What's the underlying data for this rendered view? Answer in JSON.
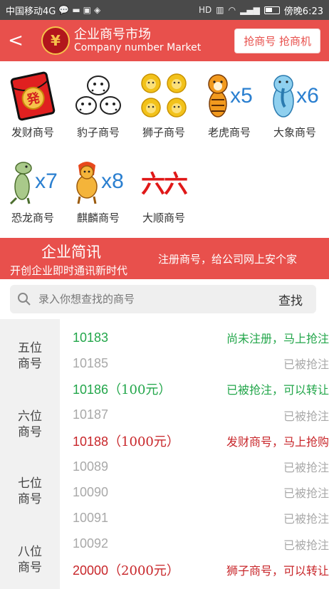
{
  "status_bar": {
    "carrier": "中国移动4G",
    "time": "傍晚6:23"
  },
  "header": {
    "back": "<",
    "logo": "¥",
    "title_cn": "企业商号市场",
    "title_en": "Company number Market",
    "grab_button": "抢商号 抢商机"
  },
  "categories": [
    {
      "label": "发财商号",
      "icon": "red-envelope-fa"
    },
    {
      "label": "豹子商号",
      "icon": "three-leopards"
    },
    {
      "label": "狮子商号",
      "icon": "four-lions"
    },
    {
      "label": "老虎商号",
      "icon": "tiger",
      "multiplier": "x5"
    },
    {
      "label": "大象商号",
      "icon": "elephant",
      "multiplier": "x6"
    },
    {
      "label": "恐龙商号",
      "icon": "dinosaur",
      "multiplier": "x7"
    },
    {
      "label": "麒麟商号",
      "icon": "qilin",
      "multiplier": "x8"
    },
    {
      "label": "大顺商号",
      "icon": "liu-liu-characters",
      "glyphs": "六六"
    }
  ],
  "banner": {
    "title": "企业简讯",
    "subtitle": "开创企业即时通讯新时代",
    "slogan": "注册商号，给公司网上安个家"
  },
  "search": {
    "placeholder": "录入你想查找的商号",
    "button": "查找"
  },
  "groups": [
    {
      "line1": "五位",
      "line2": "商号"
    },
    {
      "line1": "六位",
      "line2": "商号"
    },
    {
      "line1": "七位",
      "line2": "商号"
    },
    {
      "line1": "八位",
      "line2": "商号"
    }
  ],
  "numbers": [
    {
      "number": "10183",
      "price": "",
      "status": "尚未注册，马上抢注",
      "color": "#22a64a"
    },
    {
      "number": "10185",
      "price": "",
      "status": "已被抢注",
      "color": "#a9a9a9"
    },
    {
      "number": "10186",
      "price": "（100元）",
      "status": "已被抢注，可以转让",
      "color": "#22a64a"
    },
    {
      "number": "10187",
      "price": "",
      "status": "已被抢注",
      "color": "#a9a9a9"
    },
    {
      "number": "10188",
      "price": "（1000元）",
      "status": "发财商号，马上抢购",
      "color": "#c8262a"
    },
    {
      "number": "10089",
      "price": "",
      "status": "已被抢注",
      "color": "#a9a9a9"
    },
    {
      "number": "10090",
      "price": "",
      "status": "已被抢注",
      "color": "#a9a9a9"
    },
    {
      "number": "10091",
      "price": "",
      "status": "已被抢注",
      "color": "#a9a9a9"
    },
    {
      "number": "10092",
      "price": "",
      "status": "已被抢注",
      "color": "#a9a9a9"
    },
    {
      "number": "20000",
      "price": "（2000元）",
      "status": "狮子商号，可以转让",
      "color": "#c8262a"
    }
  ],
  "colors": {
    "brand_red": "#e8504c",
    "green": "#22a64a",
    "gray": "#a9a9a9",
    "dark_red": "#c8262a"
  }
}
